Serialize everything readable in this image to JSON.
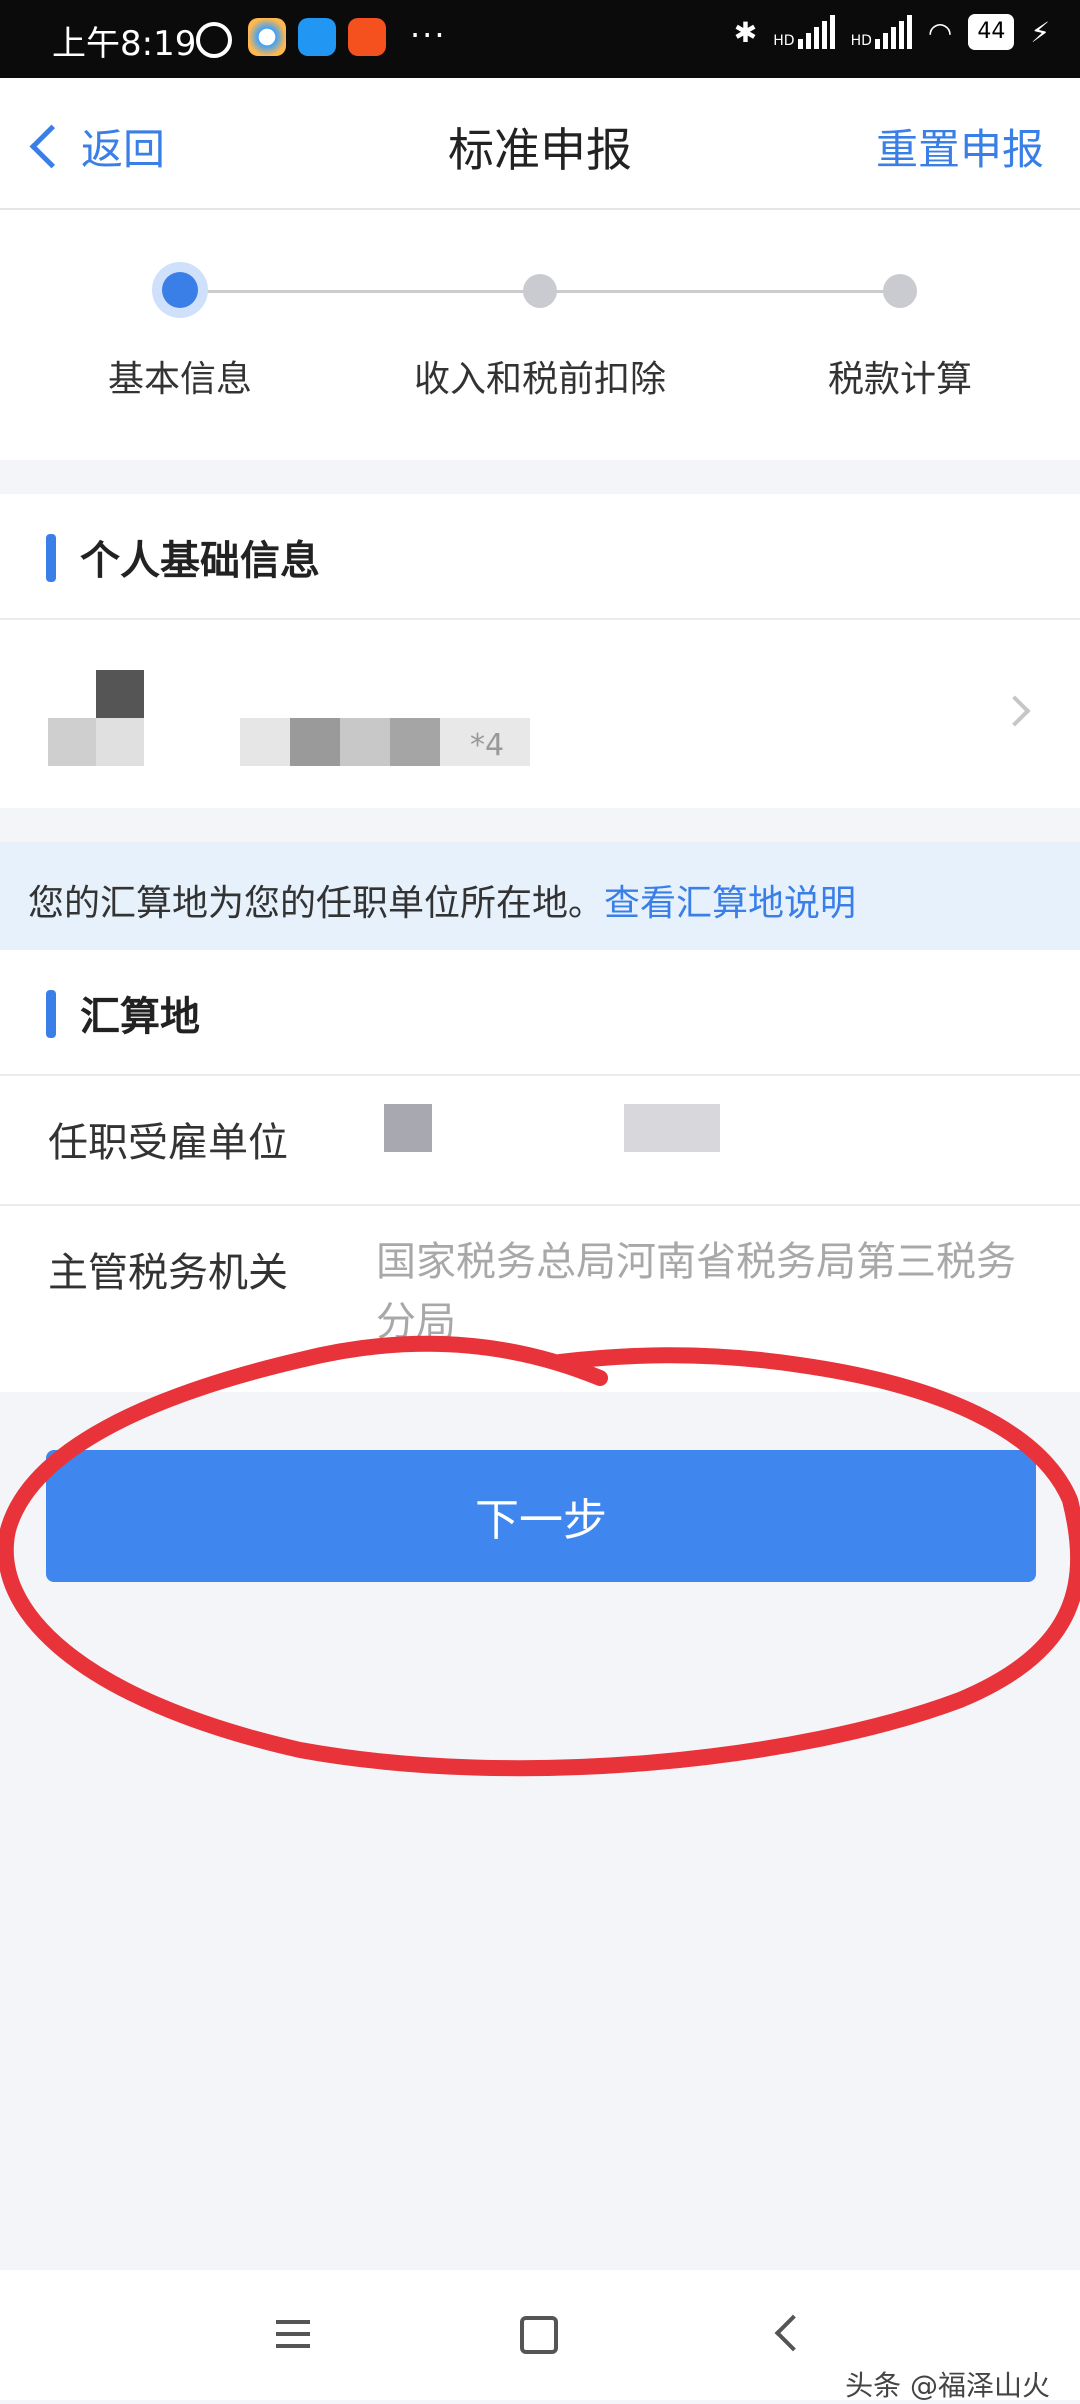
{
  "status_bar": {
    "time": "上午8:19",
    "icons": [
      "alarm-icon",
      "app-icon-1",
      "app-icon-2",
      "app-icon-3",
      "more-icon",
      "bluetooth-icon",
      "signal-hd-icon",
      "signal-hd-icon",
      "wifi-icon",
      "battery-icon",
      "charging-icon"
    ],
    "more_dots": "···",
    "hd_label": "HD",
    "battery_level": "44"
  },
  "header": {
    "back_label": "返回",
    "title": "标准申报",
    "reset_label": "重置申报"
  },
  "steps": [
    {
      "label": "基本信息",
      "active": true
    },
    {
      "label": "收入和税前扣除",
      "active": false
    },
    {
      "label": "税款计算",
      "active": false
    }
  ],
  "personal_section": {
    "title": "个人基础信息",
    "masked_suffix": "*4"
  },
  "notice": {
    "text": "您的汇算地为您的任职单位所在地。",
    "link": "查看汇算地说明"
  },
  "settlement_section": {
    "title": "汇算地",
    "rows": [
      {
        "label": "任职受雇单位",
        "value": ""
      },
      {
        "label": "主管税务机关",
        "value": "国家税务总局河南省税务局第三税务分局"
      }
    ]
  },
  "next_button": "下一步",
  "nav_bar": {
    "icons": [
      "menu-icon",
      "home-icon",
      "back-icon"
    ]
  },
  "watermark": "头条 @福泽山火",
  "colors": {
    "accent": "#3a7fe8",
    "button": "#3f86ef",
    "annotation": "#e8333a",
    "notice_bg": "#e6f1fc"
  }
}
